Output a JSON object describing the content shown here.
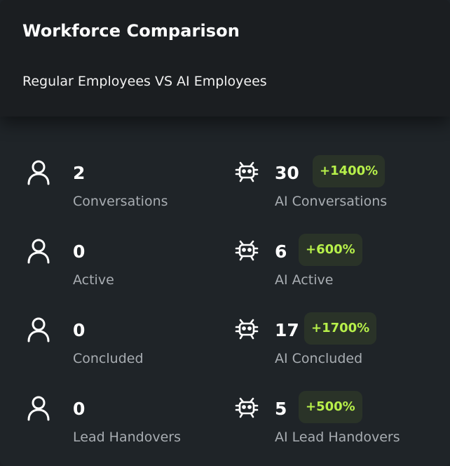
{
  "header": {
    "title": "Workforce Comparison",
    "subtitle": "Regular Employees VS AI Employees"
  },
  "colors": {
    "accent": "#b7f04a",
    "badge_bg": "#2a3328",
    "muted_text": "#a8adb2"
  },
  "regular": [
    {
      "icon": "person-icon",
      "value": "2",
      "label": "Conversations"
    },
    {
      "icon": "person-icon",
      "value": "0",
      "label": "Active"
    },
    {
      "icon": "person-icon",
      "value": "0",
      "label": "Concluded"
    },
    {
      "icon": "person-icon",
      "value": "0",
      "label": "Lead Handovers"
    }
  ],
  "ai": [
    {
      "icon": "robot-icon",
      "value": "30",
      "badge": "+1400%",
      "label": "AI Conversations"
    },
    {
      "icon": "robot-icon",
      "value": "6",
      "badge": "+600%",
      "label": "AI Active"
    },
    {
      "icon": "robot-icon",
      "value": "17",
      "badge": "+1700%",
      "label": "AI Concluded"
    },
    {
      "icon": "robot-icon",
      "value": "5",
      "badge": "+500%",
      "label": "AI Lead Handovers"
    }
  ]
}
